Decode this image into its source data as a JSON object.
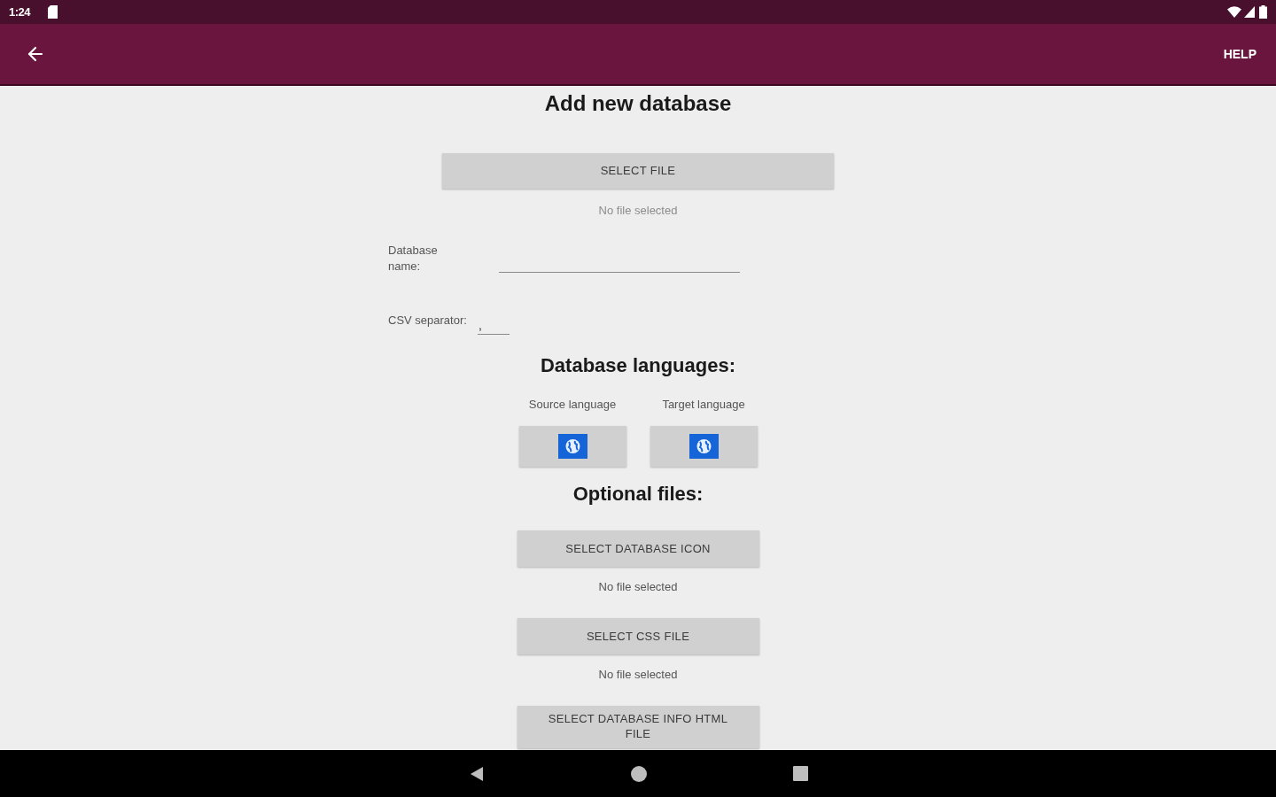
{
  "status_bar": {
    "time": "1:24"
  },
  "app_bar": {
    "action": "HELP"
  },
  "title": "Add new database",
  "file": {
    "button": "SELECT FILE",
    "status": "No file selected"
  },
  "database_name": {
    "label": "Database name:"
  },
  "csv_separator": {
    "label": "CSV separator:",
    "value": ","
  },
  "languages": {
    "heading": "Database languages:",
    "items": [
      {
        "label": "Source language"
      },
      {
        "label": "Target language"
      }
    ]
  },
  "optional_files": {
    "heading": "Optional files:",
    "items": [
      {
        "button": "SELECT DATABASE ICON",
        "status": "No file selected"
      },
      {
        "button": "SELECT CSS FILE",
        "status": "No file selected"
      },
      {
        "button": "SELECT DATABASE INFO HTML FILE"
      }
    ]
  }
}
